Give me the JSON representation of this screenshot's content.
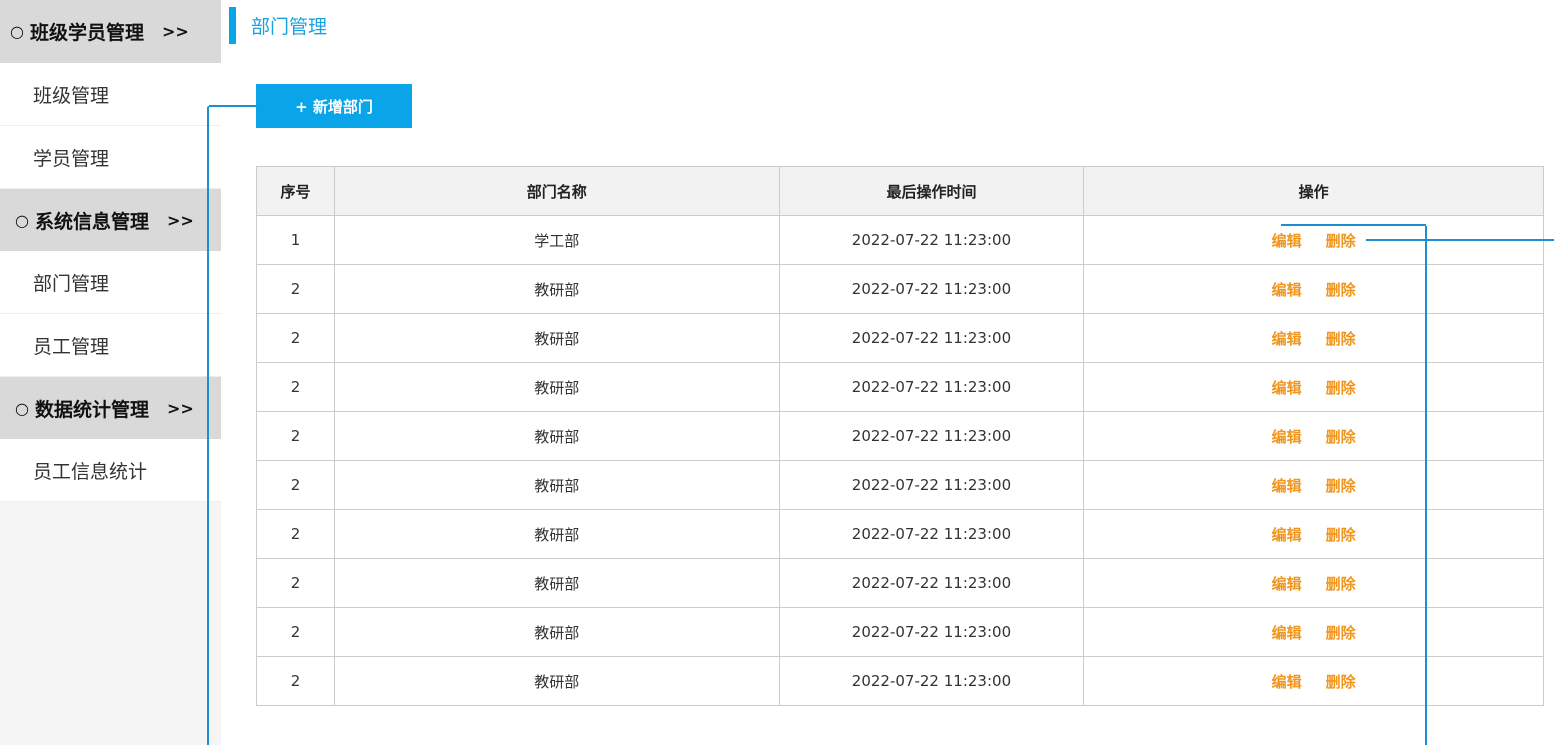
{
  "sidebar": {
    "groups": [
      {
        "bullet": "○",
        "label": "班级学员管理",
        "arrow": ">>",
        "items": [
          {
            "label": "班级管理"
          },
          {
            "label": "学员管理"
          }
        ]
      },
      {
        "bullet": "○",
        "label": "系统信息管理",
        "arrow": ">>",
        "items": [
          {
            "label": "部门管理"
          },
          {
            "label": "员工管理"
          }
        ]
      },
      {
        "bullet": "○",
        "label": "数据统计管理",
        "arrow": ">>",
        "items": [
          {
            "label": "员工信息统计"
          }
        ]
      }
    ]
  },
  "main": {
    "title": "部门管理",
    "add_button_label": "+ 新增部门",
    "table": {
      "headers": [
        "序号",
        "部门名称",
        "最后操作时间",
        "操作"
      ],
      "edit_label": "编辑",
      "delete_label": "删除",
      "rows": [
        {
          "no": "1",
          "name": "学工部",
          "time": "2022-07-22 11:23:00"
        },
        {
          "no": "2",
          "name": "教研部",
          "time": "2022-07-22 11:23:00"
        },
        {
          "no": "2",
          "name": "教研部",
          "time": "2022-07-22 11:23:00"
        },
        {
          "no": "2",
          "name": "教研部",
          "time": "2022-07-22 11:23:00"
        },
        {
          "no": "2",
          "name": "教研部",
          "time": "2022-07-22 11:23:00"
        },
        {
          "no": "2",
          "name": "教研部",
          "time": "2022-07-22 11:23:00"
        },
        {
          "no": "2",
          "name": "教研部",
          "time": "2022-07-22 11:23:00"
        },
        {
          "no": "2",
          "name": "教研部",
          "time": "2022-07-22 11:23:00"
        },
        {
          "no": "2",
          "name": "教研部",
          "time": "2022-07-22 11:23:00"
        },
        {
          "no": "2",
          "name": "教研部",
          "time": "2022-07-22 11:23:00"
        }
      ]
    }
  },
  "colors": {
    "accent": "#0aa4e8",
    "title": "#19a2e1",
    "action_link": "#f0961e",
    "annotation_line": "#1b8fd0",
    "sidebar_header_bg": "#d9d9d9"
  }
}
